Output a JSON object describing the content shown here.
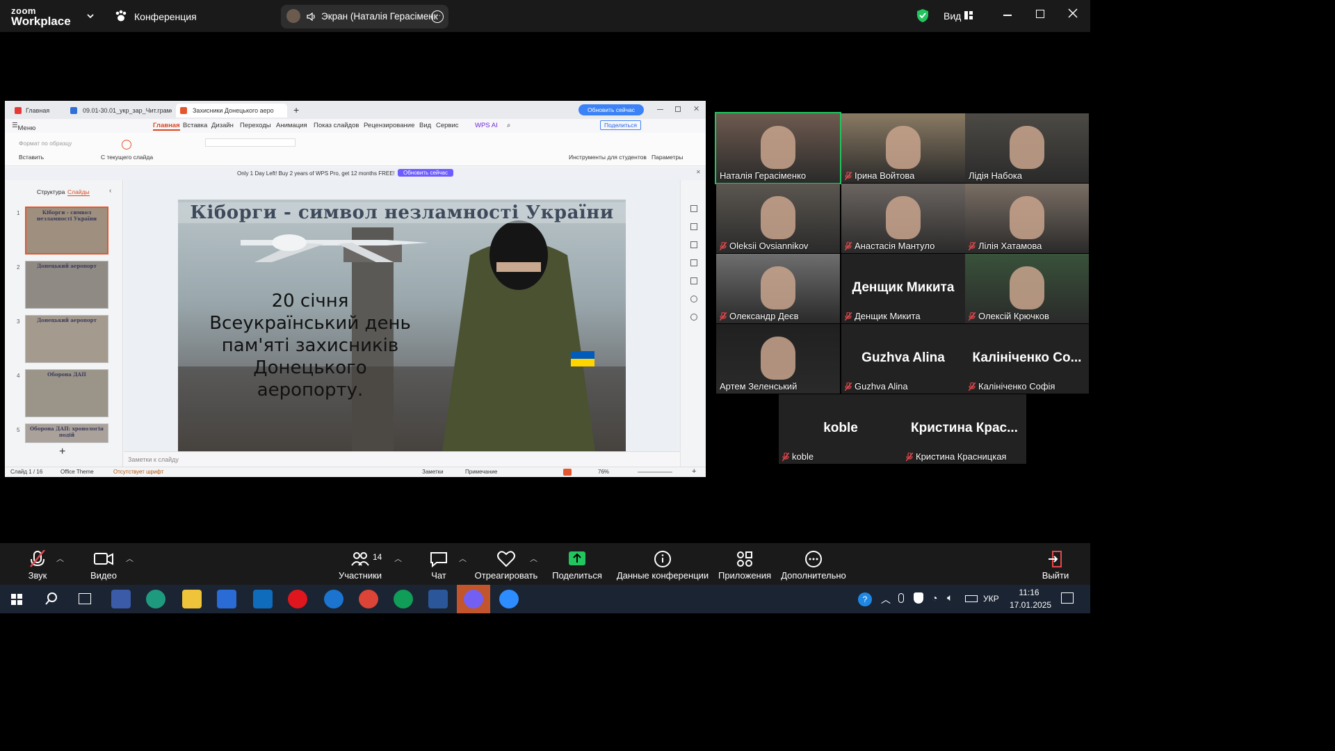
{
  "titlebar": {
    "logo_top": "zoom",
    "logo_bottom": "Workplace",
    "meeting_label": "Конференция",
    "share_label": "Экран (Наталія Герасіменк",
    "view_label": "Вид"
  },
  "wps": {
    "tabs": [
      "Главная",
      "09.01-30.01_укр_зар_Чит.грамотн",
      "Захисники Донецького аеро"
    ],
    "update_button": "Обновить сейчас",
    "menu_label": "Меню",
    "menu_items": [
      "Главная",
      "Вставка",
      "Дизайн",
      "Переходы",
      "Анимация",
      "Показ слайдов",
      "Рецензирование",
      "Вид",
      "Сервис",
      "WPS AI"
    ],
    "share_button": "Поделиться",
    "ribbon": {
      "format_painter": "Формат по образцу",
      "paste": "Вставить",
      "from_current": "С текущего слайда",
      "student_tools": "Инструменты для студентов",
      "params": "Параметры"
    },
    "promo_text": "Only 1 Day Left! Buy 2 years of WPS Pro, get 12 months FREE!",
    "promo_button": "Обновить сейчас",
    "panel_tabs": [
      "Структура",
      "Слайды"
    ],
    "thumbnails": [
      {
        "num": "1",
        "title": "Кіборги - символ незламності України"
      },
      {
        "num": "2",
        "title": "Донецький аеропорт"
      },
      {
        "num": "3",
        "title": "Донецький аеропорт"
      },
      {
        "num": "4",
        "title": "Оборона ДАП"
      },
      {
        "num": "5",
        "title": "Оборона ДАП: хронологія подій"
      }
    ],
    "slide": {
      "title": "Кіборги - символ незламності України",
      "body": [
        "20 січня",
        "Всеукраїнський день",
        "пам'яті захисників",
        "Донецького",
        "аеропорту."
      ]
    },
    "notes_placeholder": "Заметки к слайду",
    "status": {
      "slide_counter": "Слайд 1 / 16",
      "theme": "Office Theme",
      "font_missing": "Отсутствует шрифт",
      "notes": "Заметки",
      "comment": "Примечание",
      "zoom": "76%"
    }
  },
  "participants": [
    {
      "name": "Наталія Герасіменко",
      "video": true,
      "muted": false,
      "active": true
    },
    {
      "name": "Ірина Войтова",
      "video": true,
      "muted": true
    },
    {
      "name": "Лідія Набока",
      "video": true,
      "muted": false
    },
    {
      "name": "Oleksii Ovsiannikov",
      "video": true,
      "muted": true
    },
    {
      "name": "Анастасія Мантуло",
      "video": true,
      "muted": true
    },
    {
      "name": "Лілія Хатамова",
      "video": true,
      "muted": true
    },
    {
      "name": "Олександр Деєв",
      "video": true,
      "muted": true
    },
    {
      "name": "Денщик Микита",
      "video": false,
      "muted": true,
      "big": "Денщик Микита"
    },
    {
      "name": "Олексій Крючков",
      "video": true,
      "muted": true
    },
    {
      "name": "Артем Зеленський",
      "video": true,
      "muted": false
    },
    {
      "name": "Guzhva Alina",
      "video": false,
      "muted": true,
      "big": "Guzhva Alina"
    },
    {
      "name": "Калініченко Софія",
      "video": false,
      "muted": true,
      "big": "Калініченко Со..."
    },
    {
      "name": "koble",
      "video": false,
      "muted": true,
      "big": "koble"
    },
    {
      "name": "Кристина Красницкая",
      "video": false,
      "muted": true,
      "big": "Кристина Крас..."
    }
  ],
  "toolbar": {
    "audio": "Звук",
    "video": "Видео",
    "participants": "Участники",
    "participants_count": "14",
    "chat": "Чат",
    "react": "Отреагировать",
    "share": "Поделиться",
    "meeting_info": "Данные конференции",
    "apps": "Приложения",
    "more": "Дополнительно",
    "leave": "Выйти"
  },
  "taskbar": {
    "lang": "УКР",
    "time": "11:16",
    "date": "17.01.2025"
  }
}
